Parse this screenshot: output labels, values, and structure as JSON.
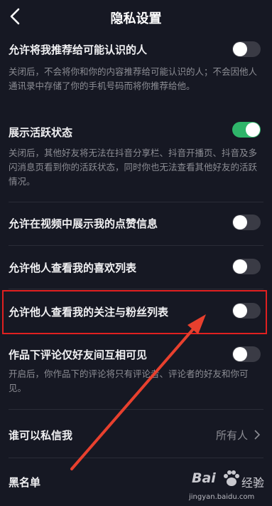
{
  "header": {
    "title": "隐私设置"
  },
  "settings": [
    {
      "label": "允许将我推荐给可能认识的人",
      "enabled": false,
      "description": "关闭后，不会将你和你的内容推荐给可能认识的人；不会因他人通讯录中存储了你的手机号码而将你推荐给他。"
    },
    {
      "label": "展示活跃状态",
      "enabled": true,
      "description": "关闭后，其他好友将无法在抖音分享栏、抖音开播页、抖音及多闪消息页看到你的活跃状态，同时你也无法查看其他好友的活跃情况。"
    },
    {
      "label": "允许在视频中展示我的点赞信息",
      "enabled": false
    },
    {
      "label": "允许他人查看我的喜欢列表",
      "enabled": false
    },
    {
      "label": "允许他人查看我的关注与粉丝列表",
      "enabled": false
    },
    {
      "label": "作品下评论仅好友间互相可见",
      "enabled": false,
      "description": "开启后，你作品下的评论将只有评论者、评论者的好友和你可见。"
    }
  ],
  "dm": {
    "label": "谁可以私信我",
    "value": "所有人"
  },
  "blacklist": {
    "label": "黑名单"
  },
  "watermark": {
    "brand": "Bai",
    "cn": "经验",
    "url": "jingyan.baidu.com"
  },
  "colors": {
    "background": "#161823",
    "toggle_on": "#2fb56a",
    "toggle_off": "#3a3b45",
    "highlight": "#e02020",
    "arrow": "#e8402e"
  }
}
